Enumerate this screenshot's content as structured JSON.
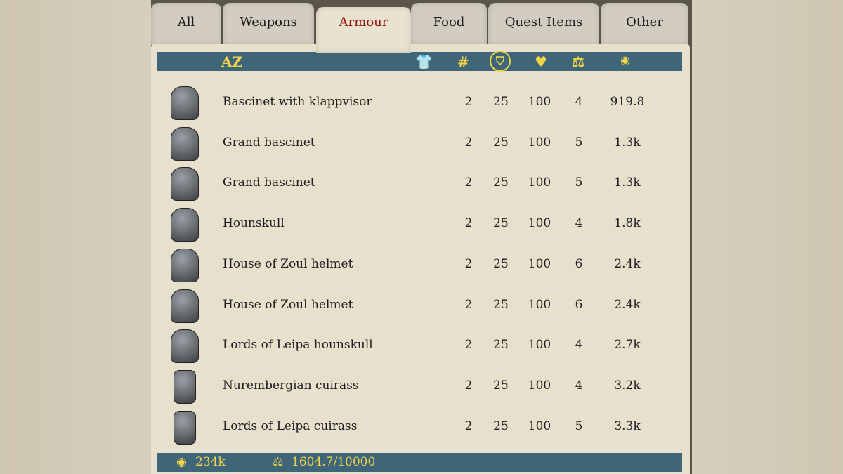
{
  "tabs": [
    "All",
    "Weapons",
    "Armour",
    "Food",
    "Quest Items",
    "Other"
  ],
  "active_tab": "Armour",
  "header": {
    "sort_label": "AZ",
    "columns": [
      "armour-type-icon",
      "#",
      "defense-icon",
      "durability-icon",
      "weight-icon",
      "price-icon"
    ],
    "count_label": "#"
  },
  "items": [
    {
      "name": "Bascinet with klappvisor",
      "count": "2",
      "defense": "25",
      "durability": "100",
      "weight": "4",
      "price": "919.8",
      "icon": "helmet-icon"
    },
    {
      "name": "Grand bascinet",
      "count": "2",
      "defense": "25",
      "durability": "100",
      "weight": "5",
      "price": "1.3k",
      "icon": "helmet-icon"
    },
    {
      "name": "Grand bascinet",
      "count": "2",
      "defense": "25",
      "durability": "100",
      "weight": "5",
      "price": "1.3k",
      "icon": "helmet-icon"
    },
    {
      "name": "Hounskull",
      "count": "2",
      "defense": "25",
      "durability": "100",
      "weight": "4",
      "price": "1.8k",
      "icon": "helmet-icon"
    },
    {
      "name": "House of Zoul helmet",
      "count": "2",
      "defense": "25",
      "durability": "100",
      "weight": "6",
      "price": "2.4k",
      "icon": "helmet-icon"
    },
    {
      "name": "House of Zoul helmet",
      "count": "2",
      "defense": "25",
      "durability": "100",
      "weight": "6",
      "price": "2.4k",
      "icon": "helmet-icon"
    },
    {
      "name": "Lords of Leipa hounskull",
      "count": "2",
      "defense": "25",
      "durability": "100",
      "weight": "4",
      "price": "2.7k",
      "icon": "helmet-icon"
    },
    {
      "name": "Nurembergian cuirass",
      "count": "2",
      "defense": "25",
      "durability": "100",
      "weight": "4",
      "price": "3.2k",
      "icon": "cuirass-icon"
    },
    {
      "name": "Lords of Leipa cuirass",
      "count": "2",
      "defense": "25",
      "durability": "100",
      "weight": "5",
      "price": "3.3k",
      "icon": "cuirass-icon"
    }
  ],
  "footer": {
    "money": "234k",
    "weight": "1604.7/10000"
  },
  "colors": {
    "bar": "#3f6678",
    "accent": "#f2d44a",
    "active_tab": "#9a0e0e"
  }
}
